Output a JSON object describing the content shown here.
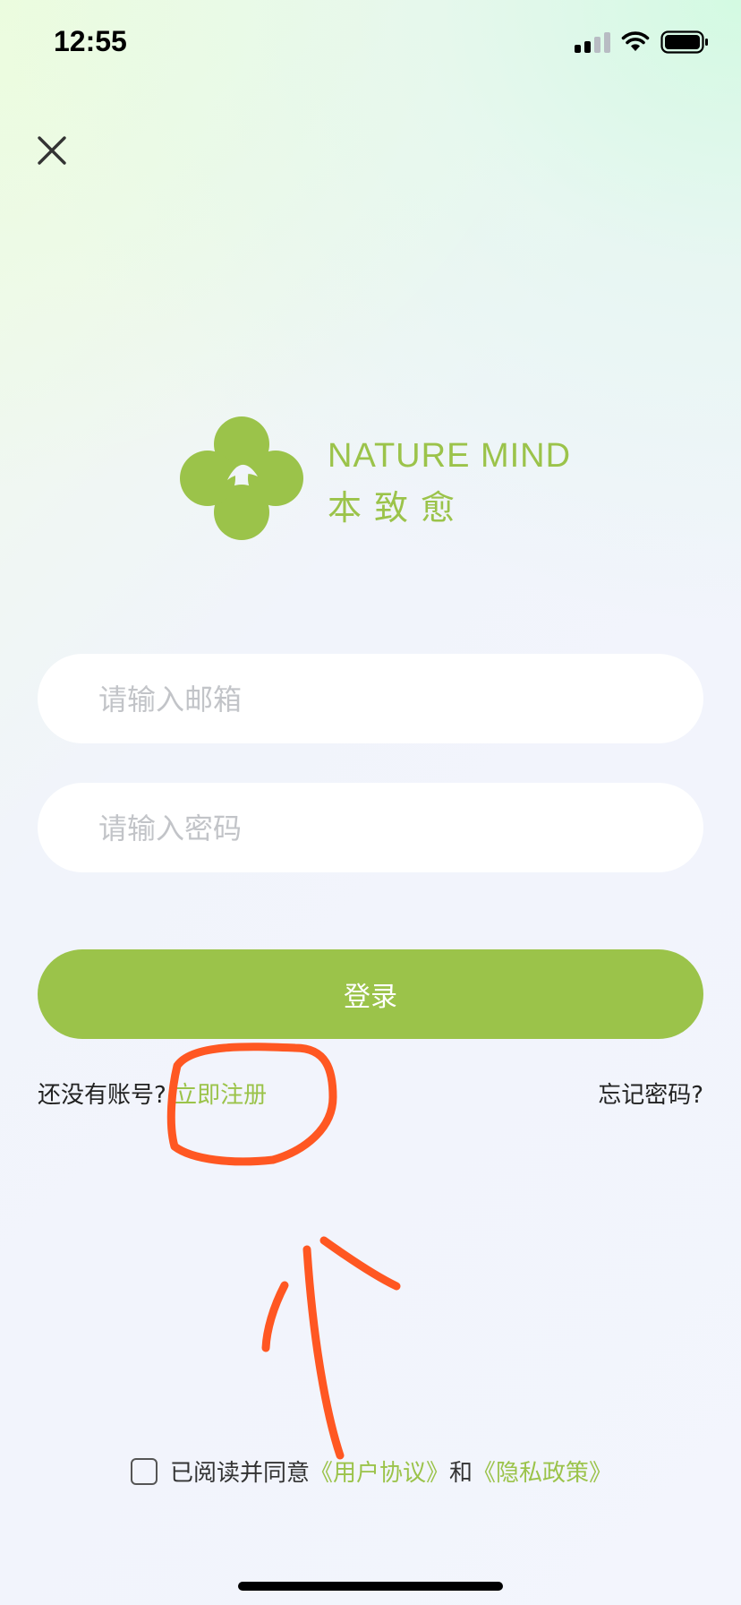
{
  "status_bar": {
    "time": "12:55",
    "icons": [
      "cellular-signal-icon",
      "wifi-icon",
      "battery-icon"
    ]
  },
  "header": {
    "close_icon": "close-icon"
  },
  "logo": {
    "brand_en": "NATURE MIND",
    "brand_cn": "本致愈",
    "color": "#9bc34a"
  },
  "form": {
    "email_placeholder": "请输入邮箱",
    "password_placeholder": "请输入密码",
    "login_label": "登录"
  },
  "links": {
    "no_account": "还没有账号?",
    "register": "立即注册",
    "forgot": "忘记密码?"
  },
  "agreement": {
    "prefix": "已阅读并同意",
    "user_agreement": "《用户协议》",
    "and": "和",
    "privacy_policy": "《隐私政策》",
    "checked": false
  },
  "colors": {
    "accent": "#9bc34a",
    "annotation": "#ff5722"
  }
}
